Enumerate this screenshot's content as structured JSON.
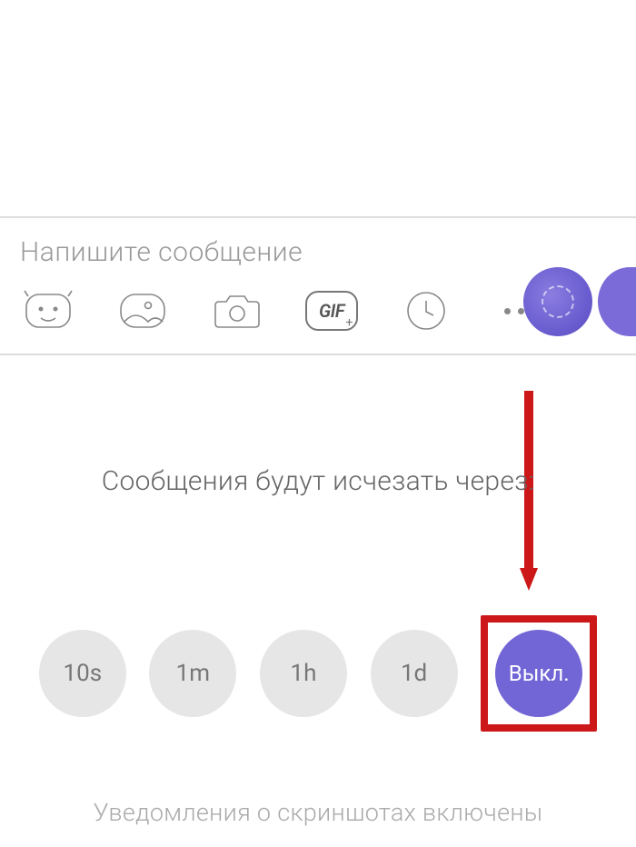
{
  "composer": {
    "placeholder": "Напишите сообщение",
    "gif_label": "GIF"
  },
  "timer": {
    "title": "Сообщения будут исчезать через:",
    "options": {
      "ten_s": "10s",
      "one_m": "1m",
      "one_h": "1h",
      "one_d": "1d",
      "off": "Выкл."
    }
  },
  "footer": {
    "note": "Уведомления о скриншотах включены"
  },
  "colors": {
    "accent": "#7265d6",
    "highlight": "#cc1818"
  }
}
